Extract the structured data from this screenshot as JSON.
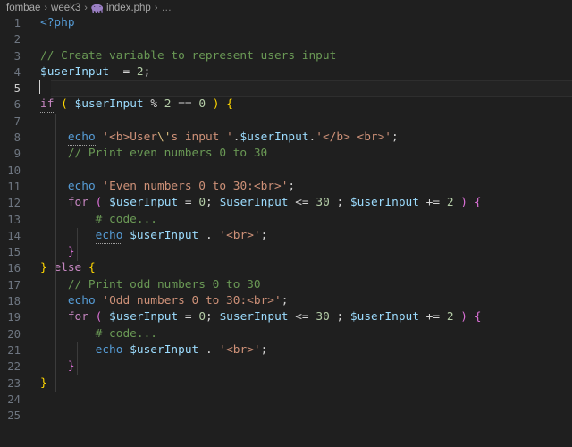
{
  "breadcrumb": {
    "items": [
      {
        "label": "fombae",
        "icon": null
      },
      {
        "label": "week3",
        "icon": null
      },
      {
        "label": "index.php",
        "icon": "php-elephant-icon"
      },
      {
        "label": "…",
        "icon": null
      }
    ],
    "separator": "›"
  },
  "editor": {
    "language": "php",
    "active_line": 5,
    "total_lines": 25,
    "colors": {
      "background": "#1f1f1f",
      "foreground": "#d4d4d4",
      "line_number": "#6e7681",
      "active_line_number": "#cccccc",
      "comment": "#6a9955",
      "keyword": "#c586c0",
      "function": "#569cd6",
      "variable": "#9cdcfe",
      "string": "#ce9178",
      "number": "#b5cea8",
      "escape": "#d7ba7d",
      "bracket_level_1": "#ffd700",
      "bracket_level_2": "#da70d6",
      "bracket_level_3": "#179fff"
    },
    "line_numbers": [
      "1",
      "2",
      "3",
      "4",
      "5",
      "6",
      "7",
      "8",
      "9",
      "10",
      "11",
      "12",
      "13",
      "14",
      "15",
      "16",
      "17",
      "18",
      "19",
      "20",
      "21",
      "22",
      "23",
      "24",
      "25"
    ],
    "lines": [
      {
        "n": "1",
        "text": "<?php"
      },
      {
        "n": "2",
        "text": ""
      },
      {
        "n": "3",
        "text": "// Create variable to represent users input"
      },
      {
        "n": "4",
        "text": "$userInput  = 2;"
      },
      {
        "n": "5",
        "text": ""
      },
      {
        "n": "6",
        "text": "if ( $userInput % 2 == 0 ) {"
      },
      {
        "n": "7",
        "text": ""
      },
      {
        "n": "8",
        "text": "    echo '<b>User\\'s input '.$userInput.'</b> <br>';"
      },
      {
        "n": "9",
        "text": "    // Print even numbers 0 to 30"
      },
      {
        "n": "10",
        "text": ""
      },
      {
        "n": "11",
        "text": "    echo 'Even numbers 0 to 30:<br>';"
      },
      {
        "n": "12",
        "text": "    for ( $userInput = 0; $userInput <= 30 ; $userInput += 2 ) {"
      },
      {
        "n": "13",
        "text": "        # code..."
      },
      {
        "n": "14",
        "text": "        echo $userInput . '<br>';"
      },
      {
        "n": "15",
        "text": "    }"
      },
      {
        "n": "16",
        "text": "} else {"
      },
      {
        "n": "17",
        "text": "    // Print odd numbers 0 to 30"
      },
      {
        "n": "18",
        "text": "    echo 'Odd numbers 0 to 30:<br>';"
      },
      {
        "n": "19",
        "text": "    for ( $userInput = 0; $userInput <= 30 ; $userInput += 2 ) {"
      },
      {
        "n": "20",
        "text": "        # code..."
      },
      {
        "n": "21",
        "text": "        echo $userInput . '<br>';"
      },
      {
        "n": "22",
        "text": "    }"
      },
      {
        "n": "23",
        "text": "}"
      },
      {
        "n": "24",
        "text": ""
      },
      {
        "n": "25",
        "text": ""
      }
    ]
  }
}
